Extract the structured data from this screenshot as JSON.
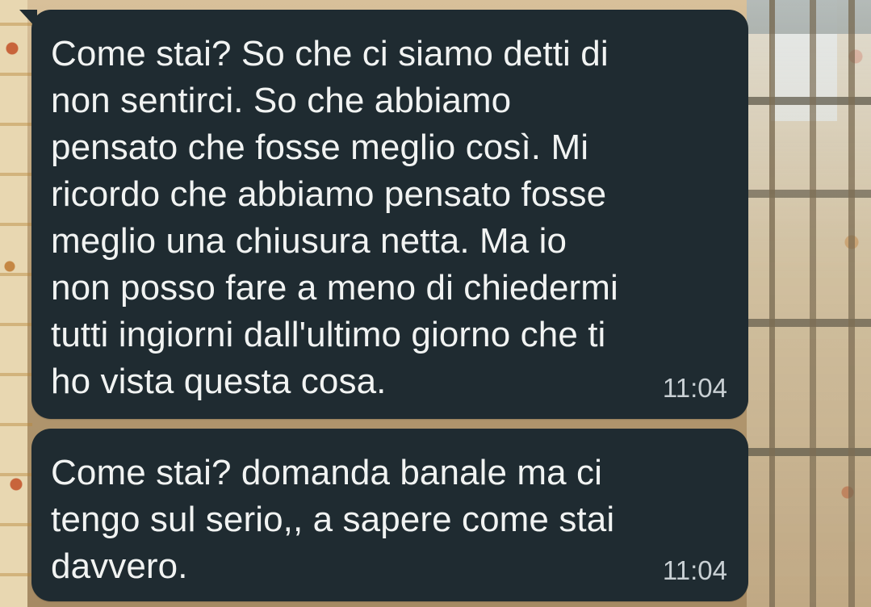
{
  "conversation": {
    "messages": [
      {
        "text": "Come stai? So che ci siamo detti di non sentirci. So che abbiamo pensato che fosse meglio così. Mi ricordo che abbiamo pensato fosse meglio una chiusura netta. Ma io non posso fare a meno di chiedermi tutti ingiorni dall'ultimo giorno che ti ho vista questa cosa.",
        "time": "11:04"
      },
      {
        "text": "Come stai? domanda banale ma ci tengo sul serio,, a sapere come stai davvero.",
        "time": "11:04"
      }
    ]
  },
  "colors": {
    "bubble_background": "#1f2b31",
    "message_text": "#f1f3f2",
    "timestamp_text": "#c9d0d4"
  }
}
